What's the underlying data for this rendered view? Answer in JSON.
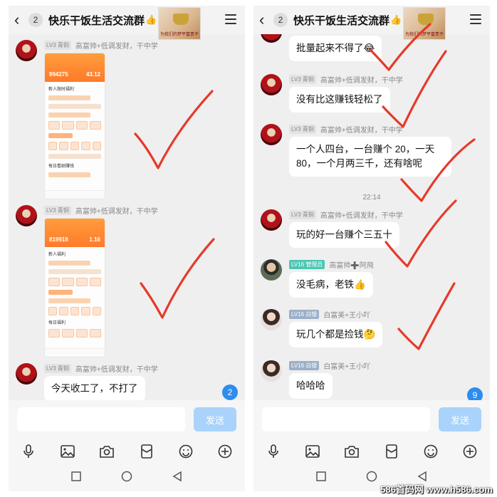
{
  "header": {
    "back_icon": "chevron-left-icon",
    "back_count": "2",
    "title": "快乐干饭生活交流群",
    "title_emoji": "👍👍",
    "menu_icon": "menu-icon",
    "thumb_caption": "为我们的梦平富贵干一杯"
  },
  "left": {
    "msgs": [
      {
        "level": "LV3 青铜",
        "sender": "高富帅+低调发财，干中学",
        "type": "image",
        "shot": {
          "amount": "994275",
          "amount2": "43.12",
          "section": "新人限时福利",
          "section2": "每日看剧赚钱"
        }
      },
      {
        "level": "LV3 青铜",
        "sender": "高富帅+低调发财，干中学",
        "type": "image",
        "shot": {
          "amount": "819918",
          "amount2": "1.16",
          "section": "新人福利",
          "section2": "每日福利"
        }
      },
      {
        "level": "LV3 青铜",
        "sender": "高富帅+低调发财，干中学",
        "type": "text",
        "text": "今天收工了，不打了"
      }
    ],
    "unread": "2"
  },
  "right": {
    "msgs": [
      {
        "level": "",
        "sender": "",
        "text": "批量起来不得了😂"
      },
      {
        "level": "LV3 青铜",
        "sender": "高富帅+低调发财，干中学",
        "text": "没有比这赚钱轻松了"
      },
      {
        "level": "LV3 青铜",
        "sender": "高富帅+低调发财，干中学",
        "text": "一个人四台，一台赚个 20，一天 80，一个月两三千，还有啥呢"
      },
      {
        "level": "LV3 青铜",
        "sender": "高富帅+低调发财，干中学",
        "text": "玩的好一台赚个三五十"
      },
      {
        "level": "LV16 管理员",
        "sender": "高富帅➕阿飛",
        "text": "没毛病，老铁👍"
      },
      {
        "level": "LV16 白银",
        "sender": "白富美+王小吖",
        "text": "玩几个都是捡钱🤔"
      },
      {
        "level": "LV16 白银",
        "sender": "白富美+王小吖",
        "text": "哈哈哈"
      }
    ],
    "time": "22:14",
    "unread": "9"
  },
  "composer": {
    "placeholder": "",
    "send_label": "发送"
  },
  "toolbar_icons": [
    "microphone-icon",
    "image-icon",
    "camera-icon",
    "red-packet-icon",
    "emoji-icon",
    "plus-icon"
  ],
  "system_nav_icons": [
    "recent-apps-icon",
    "home-icon",
    "back-icon"
  ],
  "watermark": "586首码网 www.h586.com",
  "colors": {
    "checkmark": "#e53a2a",
    "send_button": "#a9d3fb",
    "badge": "#2d8cf0"
  }
}
